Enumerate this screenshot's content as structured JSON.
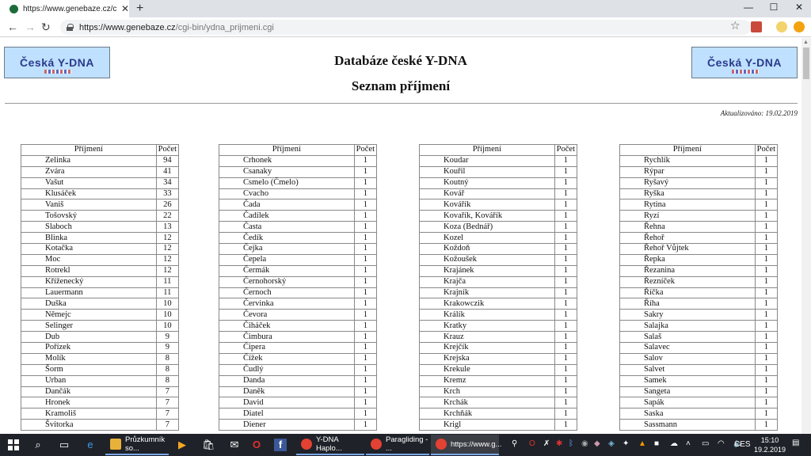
{
  "browser": {
    "tab_title": "https://www.genebaze.cz/cgi-bin",
    "url_host": "https://www.genebaze.cz",
    "url_path": "/cgi-bin/ydna_prijmeni.cgi"
  },
  "page": {
    "logo_text": "Česká Y-DNA",
    "title": "Databáze české Y-DNA",
    "subtitle": "Seznam příjmení",
    "updated": "Aktualizováno: 19.02.2019",
    "header_name": "Příjmení",
    "header_count": "Počet",
    "columns": [
      [
        [
          "Zelinka",
          "94"
        ],
        [
          "Zvára",
          "41"
        ],
        [
          "Vašut",
          "34"
        ],
        [
          "Klusáček",
          "33"
        ],
        [
          "Vaniš",
          "26"
        ],
        [
          "Tošovský",
          "22"
        ],
        [
          "Slaboch",
          "13"
        ],
        [
          "Blinka",
          "12"
        ],
        [
          "Kotačka",
          "12"
        ],
        [
          "Moc",
          "12"
        ],
        [
          "Rotrekl",
          "12"
        ],
        [
          "Kříženecký",
          "11"
        ],
        [
          "Lauermann",
          "11"
        ],
        [
          "Duška",
          "10"
        ],
        [
          "Němejc",
          "10"
        ],
        [
          "Selinger",
          "10"
        ],
        [
          "Dub",
          "9"
        ],
        [
          "Pořízek",
          "9"
        ],
        [
          "Molík",
          "8"
        ],
        [
          "Šorm",
          "8"
        ],
        [
          "Urban",
          "8"
        ],
        [
          "Dančák",
          "7"
        ],
        [
          "Hronek",
          "7"
        ],
        [
          "Kramoliš",
          "7"
        ],
        [
          "Švitorka",
          "7"
        ]
      ],
      [
        [
          "Crhonek",
          "1"
        ],
        [
          "Csanaky",
          "1"
        ],
        [
          "Csmelo (Čmelo)",
          "1"
        ],
        [
          "Cvacho",
          "1"
        ],
        [
          "Čada",
          "1"
        ],
        [
          "Čadílek",
          "1"
        ],
        [
          "Časta",
          "1"
        ],
        [
          "Čedík",
          "1"
        ],
        [
          "Čejka",
          "1"
        ],
        [
          "Čepela",
          "1"
        ],
        [
          "Čermák",
          "1"
        ],
        [
          "Černohorský",
          "1"
        ],
        [
          "Černoch",
          "1"
        ],
        [
          "Červinka",
          "1"
        ],
        [
          "Čevora",
          "1"
        ],
        [
          "Čiháček",
          "1"
        ],
        [
          "Čimbura",
          "1"
        ],
        [
          "Čipera",
          "1"
        ],
        [
          "Čížek",
          "1"
        ],
        [
          "Čudlý",
          "1"
        ],
        [
          "Danda",
          "1"
        ],
        [
          "Daněk",
          "1"
        ],
        [
          "David",
          "1"
        ],
        [
          "Diatel",
          "1"
        ],
        [
          "Diener",
          "1"
        ]
      ],
      [
        [
          "Koudar",
          "1"
        ],
        [
          "Kouřil",
          "1"
        ],
        [
          "Koutný",
          "1"
        ],
        [
          "Kovář",
          "1"
        ],
        [
          "Kovářík",
          "1"
        ],
        [
          "Kovařík, Kovářík",
          "1"
        ],
        [
          "Koza (Bednář)",
          "1"
        ],
        [
          "Kozel",
          "1"
        ],
        [
          "Koždoň",
          "1"
        ],
        [
          "Kožoušek",
          "1"
        ],
        [
          "Krajánek",
          "1"
        ],
        [
          "Krajča",
          "1"
        ],
        [
          "Krajník",
          "1"
        ],
        [
          "Krakowczik",
          "1"
        ],
        [
          "Králík",
          "1"
        ],
        [
          "Kratky",
          "1"
        ],
        [
          "Krauz",
          "1"
        ],
        [
          "Krejčík",
          "1"
        ],
        [
          "Krejska",
          "1"
        ],
        [
          "Krekule",
          "1"
        ],
        [
          "Kremz",
          "1"
        ],
        [
          "Krch",
          "1"
        ],
        [
          "Krchák",
          "1"
        ],
        [
          "Krchňák",
          "1"
        ],
        [
          "Krigl",
          "1"
        ]
      ],
      [
        [
          "Rychlík",
          "1"
        ],
        [
          "Rýpar",
          "1"
        ],
        [
          "Ryšavý",
          "1"
        ],
        [
          "Ryška",
          "1"
        ],
        [
          "Rytina",
          "1"
        ],
        [
          "Ryzí",
          "1"
        ],
        [
          "Řehna",
          "1"
        ],
        [
          "Řehoř",
          "1"
        ],
        [
          "Řehoř Vůjtek",
          "1"
        ],
        [
          "Řepka",
          "1"
        ],
        [
          "Řezanina",
          "1"
        ],
        [
          "Řezníček",
          "1"
        ],
        [
          "Říčka",
          "1"
        ],
        [
          "Říha",
          "1"
        ],
        [
          "Sakry",
          "1"
        ],
        [
          "Salajka",
          "1"
        ],
        [
          "Salaš",
          "1"
        ],
        [
          "Salavec",
          "1"
        ],
        [
          "Salov",
          "1"
        ],
        [
          "Salvet",
          "1"
        ],
        [
          "Samek",
          "1"
        ],
        [
          "Sangeta",
          "1"
        ],
        [
          "Sapák",
          "1"
        ],
        [
          "Saska",
          "1"
        ],
        [
          "Sassmann",
          "1"
        ]
      ]
    ]
  },
  "taskbar": {
    "tasks": [
      {
        "label": "Průzkumník so...",
        "color": "#e8b23a"
      },
      {
        "label": "Y-DNA Haplo...",
        "color": "#e34133"
      },
      {
        "label": "Paragliding - ...",
        "color": "#e34133"
      },
      {
        "label": "https://www.g...",
        "color": "#e34133"
      }
    ],
    "lang": "CES",
    "time": "15:10",
    "date": "19.2.2019"
  }
}
